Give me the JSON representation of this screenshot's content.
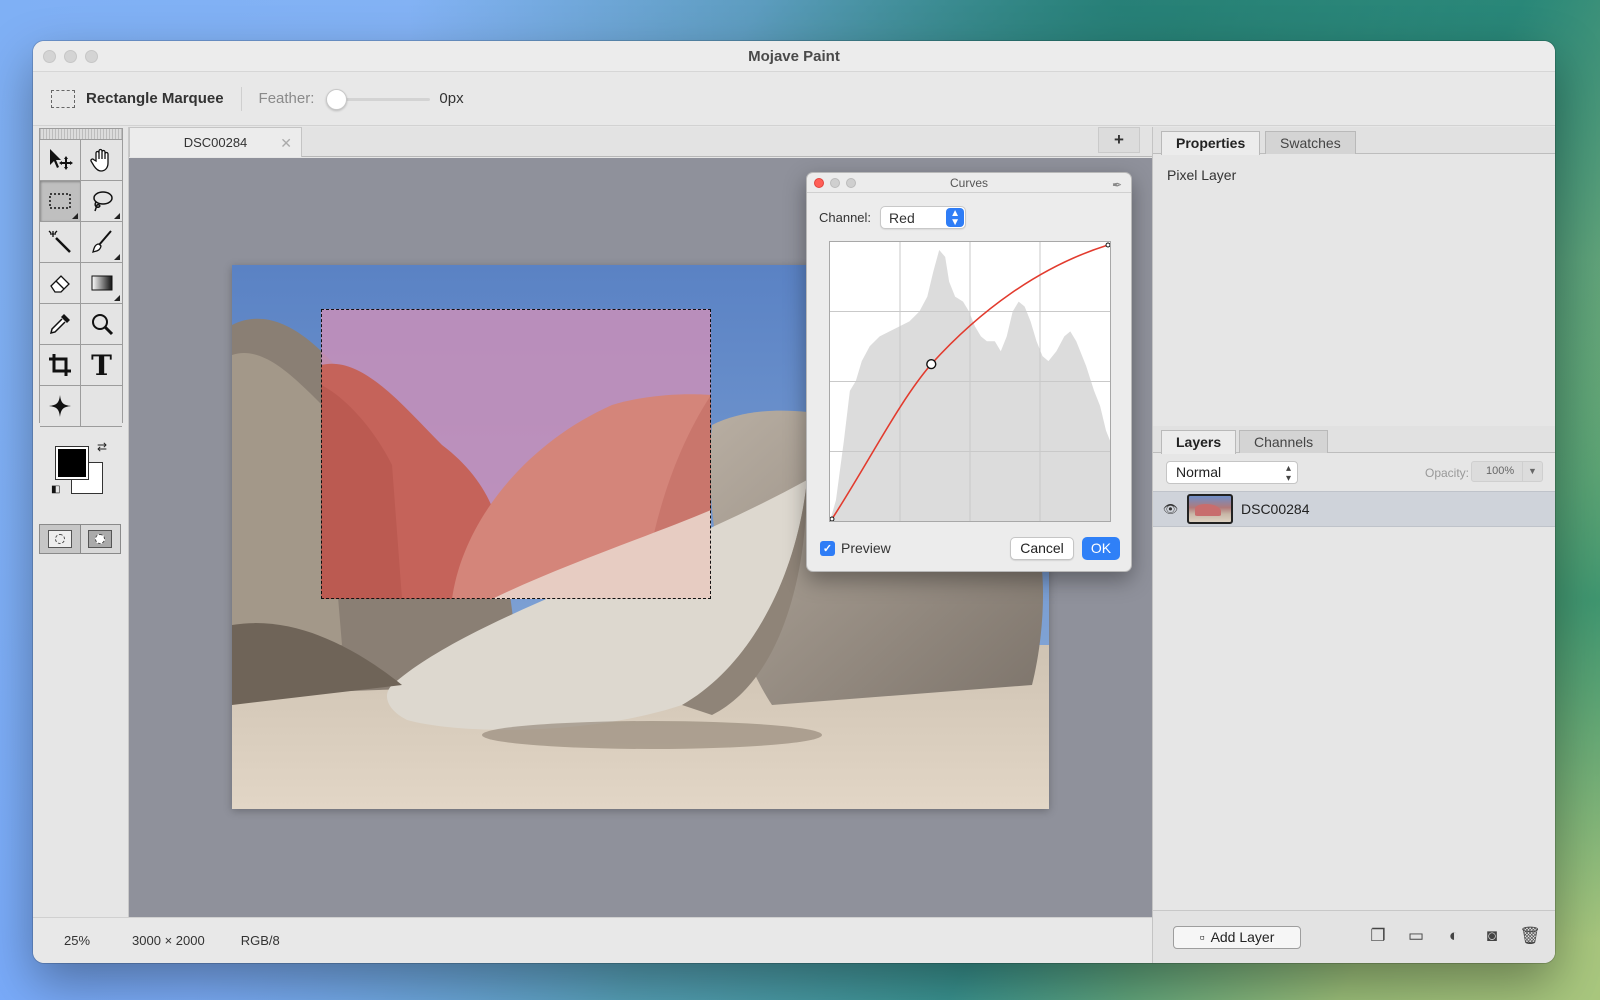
{
  "window": {
    "title": "Mojave Paint"
  },
  "options_bar": {
    "tool_name": "Rectangle Marquee",
    "feather_label": "Feather:",
    "feather_value": "0px",
    "feather_level": 0
  },
  "toolbox": {
    "tools": [
      {
        "name": "move-tool",
        "icon": "move-icon"
      },
      {
        "name": "hand-tool",
        "icon": "hand-icon"
      },
      {
        "name": "rectangle-marquee-tool",
        "icon": "marquee-icon",
        "selected": true
      },
      {
        "name": "lasso-tool",
        "icon": "lasso-icon"
      },
      {
        "name": "magic-wand-tool",
        "icon": "magic-wand-icon"
      },
      {
        "name": "brush-tool",
        "icon": "brush-icon"
      },
      {
        "name": "eraser-tool",
        "icon": "eraser-icon"
      },
      {
        "name": "gradient-tool",
        "icon": "gradient-icon"
      },
      {
        "name": "eyedropper-tool",
        "icon": "eyedropper-icon"
      },
      {
        "name": "zoom-tool",
        "icon": "zoom-icon"
      },
      {
        "name": "crop-tool",
        "icon": "crop-icon"
      },
      {
        "name": "text-tool",
        "icon": "text-icon",
        "glyph": "T"
      },
      {
        "name": "sparkle-tool",
        "icon": "sparkle-icon"
      }
    ],
    "foreground_color": "#000000",
    "background_color": "#ffffff"
  },
  "document": {
    "tab_label": "DSC00284",
    "new_tab_label": "+"
  },
  "curves_dialog": {
    "title": "Curves",
    "channel_label": "Channel:",
    "channel_value": "Red",
    "preview_label": "Preview",
    "preview_checked": true,
    "cancel_label": "Cancel",
    "ok_label": "OK",
    "curve_color": "#e23b2e"
  },
  "right_panel": {
    "top_tabs": [
      "Properties",
      "Swatches"
    ],
    "properties_text": "Pixel Layer",
    "bottom_tabs": [
      "Layers",
      "Channels"
    ],
    "blend_mode": "Normal",
    "opacity_label": "Opacity:",
    "opacity_value": "100%",
    "layers": [
      {
        "name": "DSC00284",
        "visible": true
      }
    ],
    "add_layer_label": "Add Layer"
  },
  "status_bar": {
    "zoom": "25%",
    "dimensions": "3000 × 2000",
    "mode": "RGB/8"
  },
  "colors": {
    "accent": "#2f7df6",
    "canvas_bg": "#8f919b"
  }
}
